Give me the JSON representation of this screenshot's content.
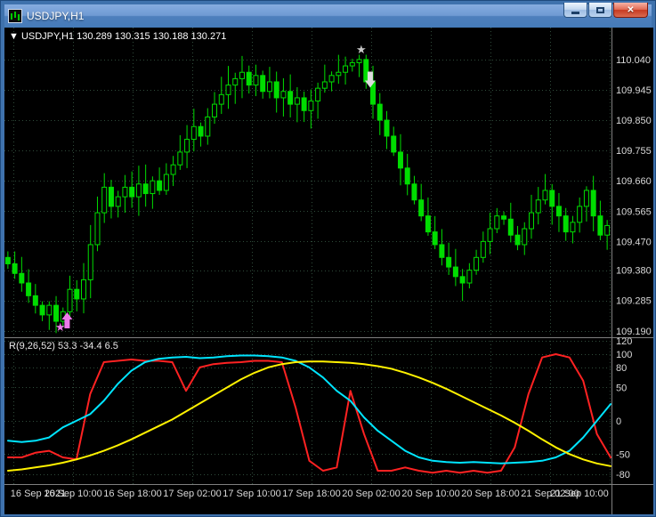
{
  "window": {
    "title": "USDJPY,H1",
    "controls": {
      "close_glyph": "✕"
    }
  },
  "chart": {
    "header": {
      "dropdown_glyph": "▼",
      "symbol": "USDJPY,H1",
      "ohlc": [
        "130.289",
        "130.315",
        "130.188",
        "130.271"
      ]
    },
    "price_axis_labels": [
      "110.040",
      "109.945",
      "109.850",
      "109.755",
      "109.660",
      "109.565",
      "109.470",
      "109.380",
      "109.285",
      "109.190"
    ],
    "time_axis_labels": [
      "16 Sep 2021",
      "16 Sep 10:00",
      "16 Sep 18:00",
      "17 Sep 02:00",
      "17 Sep 10:00",
      "17 Sep 18:00",
      "20 Sep 02:00",
      "20 Sep 10:00",
      "20 Sep 18:00",
      "21 Sep 02:00",
      "21 Sep 10:00"
    ],
    "colors": {
      "background": "#000000",
      "grid": "#2f4b3a",
      "candle": "#00DD00",
      "axis_text": "#D8D8D8",
      "header_text": "#FFFFFF",
      "separator": "#7F7F7F"
    }
  },
  "indicator_panel": {
    "label": "R(9,26,52) 53.3 -34.4 6.5",
    "axis_labels": [
      "120",
      "100",
      "80",
      "50",
      "0",
      "-50",
      "-80"
    ]
  },
  "chart_data": {
    "type": "candlestick",
    "symbol": "USDJPY",
    "timeframe": "H1",
    "price_range": [
      109.17,
      110.14
    ],
    "closes": [
      109.4,
      109.37,
      109.34,
      109.3,
      109.27,
      109.24,
      109.27,
      109.22,
      109.25,
      109.32,
      109.29,
      109.35,
      109.46,
      109.56,
      109.64,
      109.58,
      109.61,
      109.64,
      109.61,
      109.65,
      109.62,
      109.66,
      109.63,
      109.68,
      109.71,
      109.75,
      109.79,
      109.83,
      109.8,
      109.86,
      109.9,
      109.93,
      109.96,
      109.98,
      110.0,
      109.96,
      109.99,
      109.94,
      109.97,
      109.92,
      109.94,
      109.9,
      109.92,
      109.88,
      109.91,
      109.95,
      109.97,
      109.99,
      110.0,
      110.02,
      110.03,
      110.04,
      109.97,
      109.9,
      109.85,
      109.8,
      109.75,
      109.7,
      109.65,
      109.6,
      109.55,
      109.5,
      109.46,
      109.42,
      109.39,
      109.36,
      109.34,
      109.38,
      109.42,
      109.47,
      109.51,
      109.55,
      109.54,
      109.49,
      109.46,
      109.51,
      109.56,
      109.6,
      109.63,
      109.58,
      109.55,
      109.5,
      109.53,
      109.58,
      109.63,
      109.55,
      109.49,
      109.52
    ],
    "markers": [
      {
        "shape": "star",
        "glyph": "★",
        "candle": 7.6,
        "price": 109.2,
        "color": "#EE7AE9"
      },
      {
        "shape": "arrow-up",
        "candle": 8.6,
        "price": 109.248,
        "color": "#EE7AE9"
      },
      {
        "shape": "star",
        "glyph": "★",
        "candle": 51.3,
        "price": 110.07,
        "color": "#C8C8C8"
      },
      {
        "shape": "arrow-down",
        "candle": 52.6,
        "price": 109.952,
        "color": "#DCDCDC"
      }
    ],
    "oscillator": {
      "label": "R(9,26,52) 53.3 -34.4 6.5",
      "y_range": [
        -95,
        124
      ],
      "x_sampling": "45 even samples across plot width",
      "series": [
        {
          "name": "red",
          "color": "#FF2222",
          "values": [
            -55,
            -55,
            -48,
            -45,
            -55,
            -58,
            40,
            88,
            90,
            92,
            90,
            90,
            88,
            45,
            80,
            85,
            87,
            88,
            90,
            90,
            88,
            20,
            -60,
            -75,
            -70,
            45,
            -20,
            -75,
            -75,
            -70,
            -75,
            -78,
            -75,
            -78,
            -75,
            -78,
            -75,
            -40,
            40,
            95,
            100,
            95,
            60,
            -20,
            -55
          ]
        },
        {
          "name": "cyan",
          "color": "#00E5FF",
          "values": [
            -30,
            -32,
            -30,
            -25,
            -10,
            0,
            10,
            30,
            55,
            75,
            88,
            93,
            95,
            96,
            94,
            95,
            97,
            98,
            98,
            97,
            95,
            90,
            80,
            65,
            45,
            30,
            5,
            -15,
            -30,
            -45,
            -55,
            -60,
            -62,
            -63,
            -62,
            -63,
            -64,
            -63,
            -62,
            -60,
            -55,
            -45,
            -25,
            0,
            25
          ]
        },
        {
          "name": "yellow",
          "color": "#FFF200",
          "values": [
            -75,
            -73,
            -70,
            -67,
            -63,
            -58,
            -52,
            -45,
            -37,
            -28,
            -18,
            -8,
            2,
            14,
            26,
            38,
            50,
            62,
            72,
            80,
            85,
            88,
            89,
            89,
            88,
            87,
            85,
            82,
            78,
            72,
            65,
            57,
            48,
            38,
            28,
            18,
            8,
            -3,
            -15,
            -28,
            -40,
            -50,
            -58,
            -64,
            -68
          ]
        }
      ]
    }
  }
}
